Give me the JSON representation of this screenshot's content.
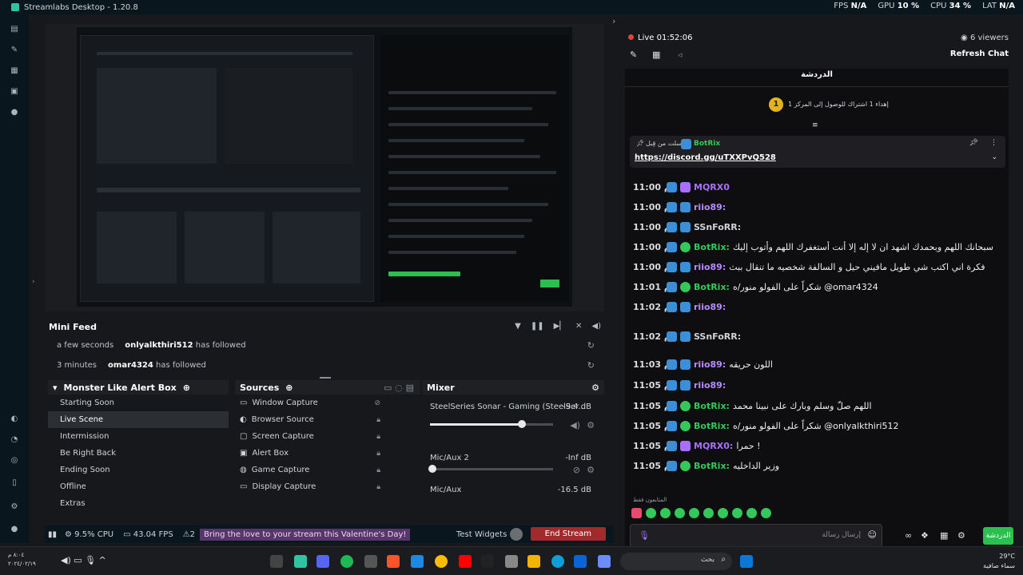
{
  "titlebar": {
    "title": "Streamlabs Desktop - 1.20.8"
  },
  "stats": {
    "fps_label": "FPS",
    "fps": "N/A",
    "gpu_label": "GPU",
    "gpu": "10 %",
    "cpu_label": "CPU",
    "cpu": "34 %",
    "lat_label": "LAT",
    "lat": "N/A"
  },
  "minifeed": {
    "title": "Mini Feed",
    "events": [
      {
        "time": "a few seconds",
        "user": "onlyalkthiri512",
        "action": "has followed"
      },
      {
        "time": "3 minutes",
        "user": "omar4324",
        "action": "has followed"
      }
    ]
  },
  "scenes": {
    "title": "Monster Like Alert Box",
    "items": [
      "Starting Soon",
      "Live Scene",
      "Intermission",
      "Be Right Back",
      "Ending Soon",
      "Offline",
      "Extras"
    ],
    "active_index": 1
  },
  "sources": {
    "title": "Sources",
    "items": [
      "Window Capture",
      "Browser Source",
      "Screen Capture",
      "Alert Box",
      "Game Capture",
      "Display Capture"
    ]
  },
  "mixer": {
    "title": "Mixer",
    "channels": [
      {
        "name": "SteelSeries Sonar - Gaming (SteelSer...",
        "db": "-9.4 dB",
        "level": 0.75
      },
      {
        "name": "Mic/Aux 2",
        "db": "-Inf dB",
        "level": 0.0
      },
      {
        "name": "Mic/Aux",
        "db": "-16.5 dB",
        "level": null
      }
    ]
  },
  "statusbar": {
    "cpu": "9.5% CPU",
    "fps": "43.04 FPS",
    "alerts": "2",
    "promo": "Bring the love to your stream this Valentine's Day!",
    "test_widgets": "Test Widgets",
    "end_stream": "End Stream"
  },
  "live": {
    "timer": "Live 01:52:06",
    "viewers": "6 viewers",
    "refresh": "Refresh Chat"
  },
  "chat": {
    "title": "الدردشة",
    "goal": "إهداء 1 اشتراك للوصول إلى المركز 1",
    "goal_rank": "1",
    "pinned_user": "BotRix",
    "pinned_by": "أرسلت من قِبل",
    "pinned_link": "https://discord.gg/uTXXPvQ528",
    "messages": [
      {
        "time": "11:00 م",
        "user": "MQRX0",
        "color": "#a970ff",
        "text": ""
      },
      {
        "time": "11:00 م",
        "user": "riio89:",
        "color": "#b88bff",
        "text": ""
      },
      {
        "time": "11:00 م",
        "user": "SSnFoRR:",
        "color": "#cfd3d7",
        "text": ""
      },
      {
        "time": "11:00 م",
        "user": "BotRix:",
        "color": "#34c759",
        "text": "سبحانك اللهم وبحمدك اشهد ان لا إله إلا أنت أستغفرك اللهم وأتوب إليك"
      },
      {
        "time": "11:00 م",
        "user": "riio89:",
        "color": "#b88bff",
        "text": "فكرة اني اكتب شي طويل مافيني حيل و السالفة شخصيه ما تنقال ببث"
      },
      {
        "time": "11:01 م",
        "user": "BotRix:",
        "color": "#34c759",
        "text": "شكراً على الفولو منور/ه @omar4324"
      },
      {
        "time": "11:02 م",
        "user": "riio89:",
        "color": "#b88bff",
        "text": ""
      },
      {
        "time": "11:02 م",
        "user": "SSnFoRR:",
        "color": "#cfd3d7",
        "text": ""
      },
      {
        "time": "11:03 م",
        "user": "riio89:",
        "color": "#b88bff",
        "text": "اللون حريقه"
      },
      {
        "time": "11:05 م",
        "user": "riio89:",
        "color": "#b88bff",
        "text": ""
      },
      {
        "time": "11:05 م",
        "user": "BotRix:",
        "color": "#34c759",
        "text": "اللهم صلّ وسلم وبارك على نبينا محمد"
      },
      {
        "time": "11:05 م",
        "user": "BotRix:",
        "color": "#34c759",
        "text": "شكراً على الفولو منور/ه @onlyalkthiri512"
      },
      {
        "time": "11:05 م",
        "user": "MQRX0:",
        "color": "#a970ff",
        "text": "حمرا !"
      },
      {
        "time": "11:05 م",
        "user": "BotRix:",
        "color": "#34c759",
        "text": "وزير الداخليه"
      }
    ],
    "input_placeholder": "إرسال رسالة",
    "send_label": "الدردشة",
    "emotes_label": "المتابعون فقط"
  },
  "taskbar": {
    "time": "٨:٠٤ م",
    "date": "٢٠٢٤/٠٢/١٩",
    "search": "بحث",
    "weather_temp": "29°C",
    "weather_desc": "سماء صافية"
  },
  "colors": {
    "accent_green": "#2bbf4f",
    "end_red": "#a22a2c",
    "promo_purple": "#58356a",
    "live_red": "#e0443f"
  }
}
